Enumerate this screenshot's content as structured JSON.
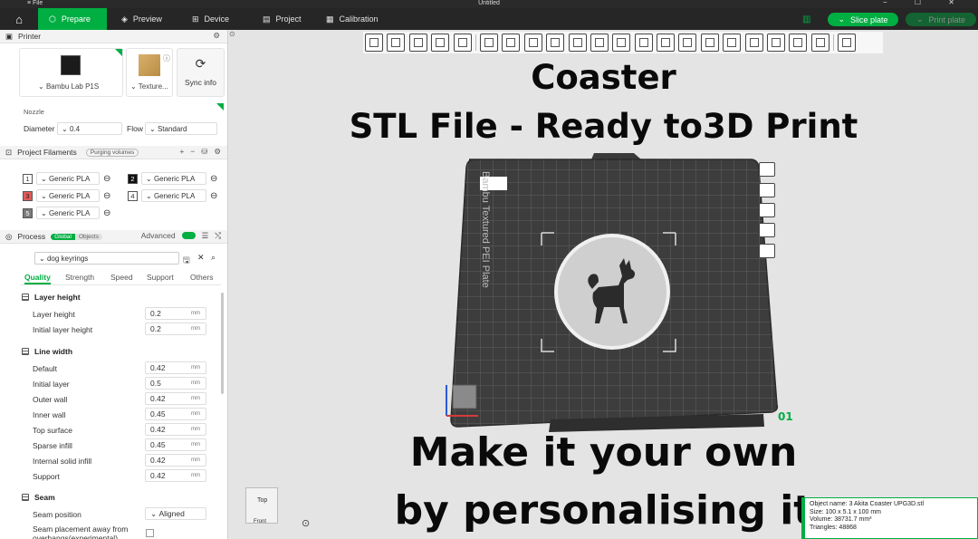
{
  "window": {
    "file_menu": "≡ File",
    "title": "Untitled",
    "controls": "−  ☐  ✕"
  },
  "topbar": {
    "tabs": [
      {
        "label": "Prepare",
        "icon": "prepare-icon"
      },
      {
        "label": "Preview",
        "icon": "preview-icon"
      },
      {
        "label": "Device",
        "icon": "device-icon"
      },
      {
        "label": "Project",
        "icon": "project-icon"
      },
      {
        "label": "Calibration",
        "icon": "calibration-icon"
      }
    ],
    "slice_label": "Slice plate",
    "print_label": "Print plate",
    "accent": "#00ae42"
  },
  "printer": {
    "section_title": "Printer",
    "printer_name": "Bambu Lab P1S",
    "plate_name": "Texture...",
    "sync_label": "Sync info",
    "nozzle_label": "Nozzle",
    "diameter_label": "Diameter",
    "diameter_value": "0.4",
    "flow_label": "Flow",
    "flow_value": "Standard"
  },
  "filaments": {
    "section_title": "Project Filaments",
    "purging_label": "Purging volumes",
    "items": [
      {
        "num": "1",
        "name": "Generic PLA",
        "color": "#ffffff"
      },
      {
        "num": "2",
        "name": "Generic PLA",
        "color": "#111111"
      },
      {
        "num": "3",
        "name": "Generic PLA",
        "color": "#e35a5a"
      },
      {
        "num": "4",
        "name": "Generic PLA",
        "color": "#ffffff"
      },
      {
        "num": "5",
        "name": "Generic PLA",
        "color": "#7a7a7a"
      }
    ]
  },
  "process": {
    "section_title": "Process",
    "toggle_global": "Global",
    "toggle_objects": "Objects",
    "advanced_label": "Advanced",
    "preset": "dog keyrings",
    "tabs": [
      "Quality",
      "Strength",
      "Speed",
      "Support",
      "Others"
    ],
    "groups": {
      "layer_height": {
        "title": "Layer height",
        "rows": [
          {
            "label": "Layer height",
            "value": "0.2",
            "unit": "mm"
          },
          {
            "label": "Initial layer height",
            "value": "0.2",
            "unit": "mm"
          }
        ]
      },
      "line_width": {
        "title": "Line width",
        "rows": [
          {
            "label": "Default",
            "value": "0.42",
            "unit": "mm"
          },
          {
            "label": "Initial layer",
            "value": "0.5",
            "unit": "mm"
          },
          {
            "label": "Outer wall",
            "value": "0.42",
            "unit": "mm"
          },
          {
            "label": "Inner wall",
            "value": "0.45",
            "unit": "mm"
          },
          {
            "label": "Top surface",
            "value": "0.42",
            "unit": "mm"
          },
          {
            "label": "Sparse infill",
            "value": "0.45",
            "unit": "mm"
          },
          {
            "label": "Internal solid infill",
            "value": "0.42",
            "unit": "mm"
          },
          {
            "label": "Support",
            "value": "0.42",
            "unit": "mm"
          }
        ]
      },
      "seam": {
        "title": "Seam",
        "rows": [
          {
            "label": "Seam position",
            "value": "Aligned"
          },
          {
            "label": "Seam placement away from overhangs(experimental)"
          }
        ]
      }
    }
  },
  "canvas": {
    "headline1": "Coaster",
    "headline2": "STL File - Ready to3D Print",
    "footer1": "Make it your own",
    "footer2": "by personalising it",
    "plate_text": "Bambu Textured PEI Plate",
    "plate_number": "01",
    "viewcube_top": "Top",
    "viewcube_front": "Front",
    "object_info": {
      "name": "Object name: 3 Akita Coaster UPG3D.stl",
      "size": "Size: 100 x 5.1 x 100 mm",
      "volume": "Volume: 38731.7 mm³",
      "triangles": "Triangles: 48868"
    }
  }
}
